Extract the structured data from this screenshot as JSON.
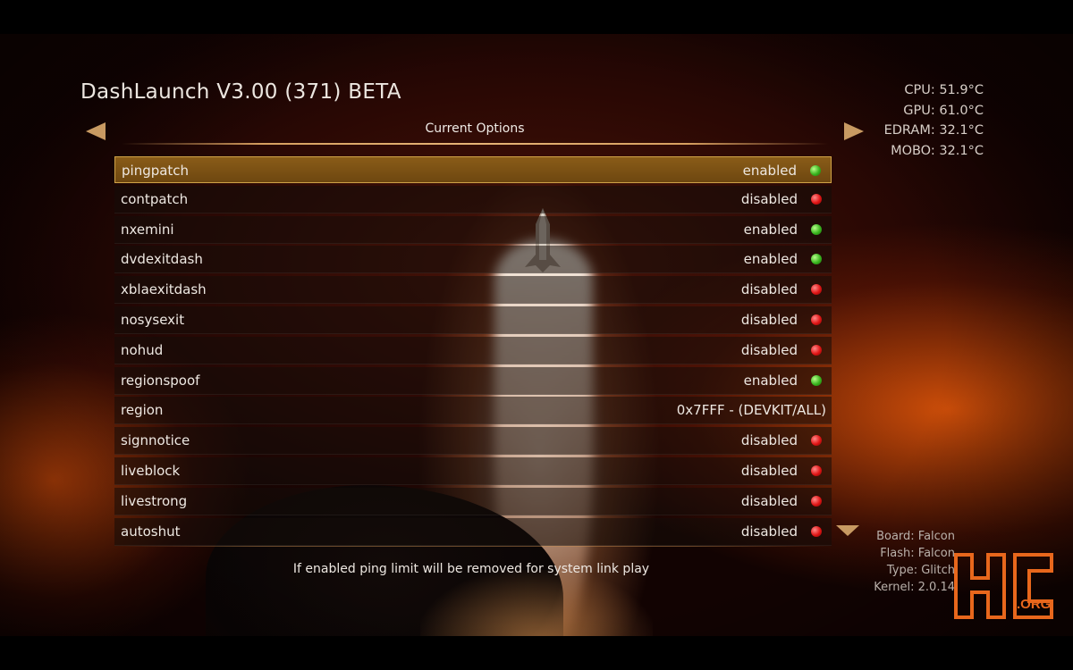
{
  "app": {
    "title": "DashLaunch V3.00 (371) BETA"
  },
  "stats": [
    {
      "label": "CPU",
      "value": "51.9°C"
    },
    {
      "label": "GPU",
      "value": "61.0°C"
    },
    {
      "label": "EDRAM",
      "value": "32.1°C"
    },
    {
      "label": "MOBO",
      "value": "32.1°C"
    }
  ],
  "stats_text": [
    "CPU: 51.9°C",
    "GPU: 61.0°C",
    "EDRAM: 32.1°C",
    "MOBO: 32.1°C"
  ],
  "tab": {
    "label": "Current Options"
  },
  "options": [
    {
      "name": "pingpatch",
      "value": "enabled",
      "status": "green",
      "selected": true
    },
    {
      "name": "contpatch",
      "value": "disabled",
      "status": "red"
    },
    {
      "name": "nxemini",
      "value": "enabled",
      "status": "green"
    },
    {
      "name": "dvdexitdash",
      "value": "enabled",
      "status": "green"
    },
    {
      "name": "xblaexitdash",
      "value": "disabled",
      "status": "red"
    },
    {
      "name": "nosysexit",
      "value": "disabled",
      "status": "red"
    },
    {
      "name": "nohud",
      "value": "disabled",
      "status": "red"
    },
    {
      "name": "regionspoof",
      "value": "enabled",
      "status": "green"
    },
    {
      "name": "region",
      "value": "0x7FFF - (DEVKIT/ALL)",
      "status": "none"
    },
    {
      "name": "signnotice",
      "value": "disabled",
      "status": "red"
    },
    {
      "name": "liveblock",
      "value": "disabled",
      "status": "red"
    },
    {
      "name": "livestrong",
      "value": "disabled",
      "status": "red"
    },
    {
      "name": "autoshut",
      "value": "disabled",
      "status": "red"
    }
  ],
  "description": "If enabled ping limit will be removed for system link play",
  "sysinfo": [
    "Board: Falcon",
    "Flash: Falcon",
    "Type: Glitch",
    "Kernel: 2.0.14"
  ],
  "logo": {
    "text": "HC",
    "suffix": ".ORG"
  },
  "colors": {
    "accent": "#c89a62",
    "selected_row": "#8a5c18",
    "enabled_dot": "#38b41e",
    "disabled_dot": "#e01414",
    "logo_orange": "#e8671c"
  },
  "icons": {
    "prev": "triangle-left-icon",
    "next": "triangle-right-icon",
    "scroll_down": "triangle-down-icon",
    "status_enabled": "green-dot-icon",
    "status_disabled": "red-dot-icon"
  }
}
